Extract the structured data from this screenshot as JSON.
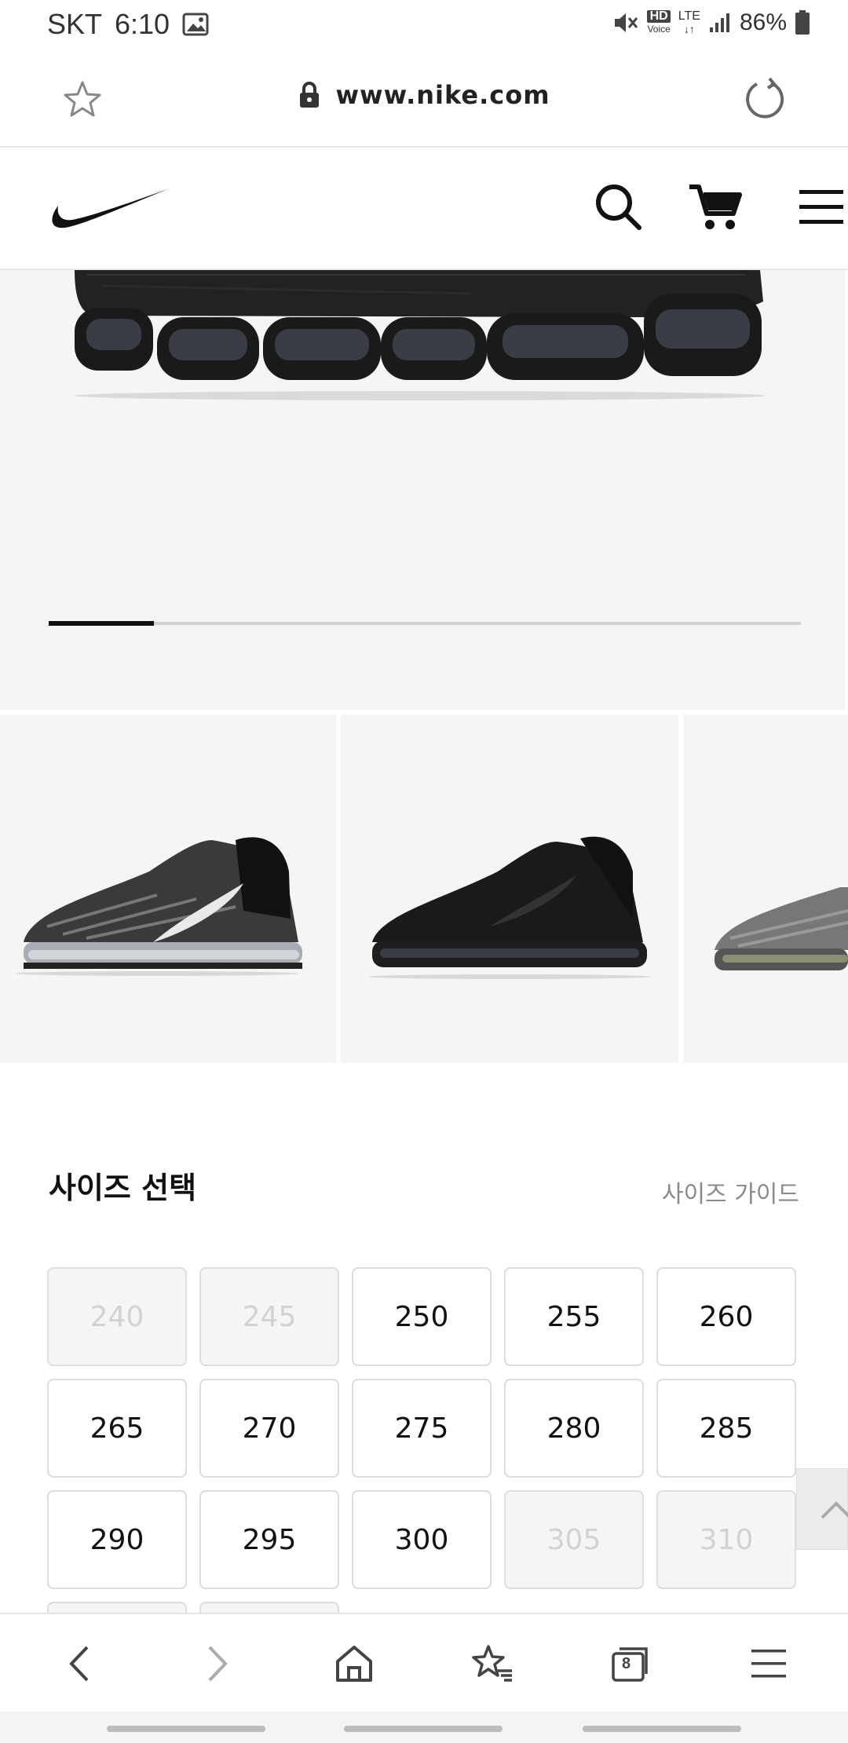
{
  "status_bar": {
    "carrier": "SKT",
    "time": "6:10",
    "network_hd": "HD",
    "network_voice": "Voice",
    "network_lte": "LTE",
    "battery": "86%"
  },
  "browser": {
    "url": "www.nike.com",
    "tab_count": "8"
  },
  "site": {
    "brand": "Nike"
  },
  "hero": {
    "progress": 0.14
  },
  "size_section": {
    "title": "사이즈 선택",
    "guide_link": "사이즈 가이드",
    "sizes": [
      {
        "label": "240",
        "available": false
      },
      {
        "label": "245",
        "available": false
      },
      {
        "label": "250",
        "available": true
      },
      {
        "label": "255",
        "available": true
      },
      {
        "label": "260",
        "available": true
      },
      {
        "label": "265",
        "available": true
      },
      {
        "label": "270",
        "available": true
      },
      {
        "label": "275",
        "available": true
      },
      {
        "label": "280",
        "available": true
      },
      {
        "label": "285",
        "available": true
      },
      {
        "label": "290",
        "available": true
      },
      {
        "label": "295",
        "available": true
      },
      {
        "label": "300",
        "available": true
      },
      {
        "label": "305",
        "available": false
      },
      {
        "label": "310",
        "available": false
      }
    ]
  },
  "icons": {
    "bookmark": "star-outline-icon",
    "lock": "lock-icon",
    "reload": "reload-icon",
    "search": "search-icon",
    "cart": "cart-icon",
    "menu": "hamburger-icon"
  },
  "colors": {
    "text": "#111111",
    "disabled_text": "#d2d2d2",
    "panel_bg": "#f5f5f5"
  }
}
